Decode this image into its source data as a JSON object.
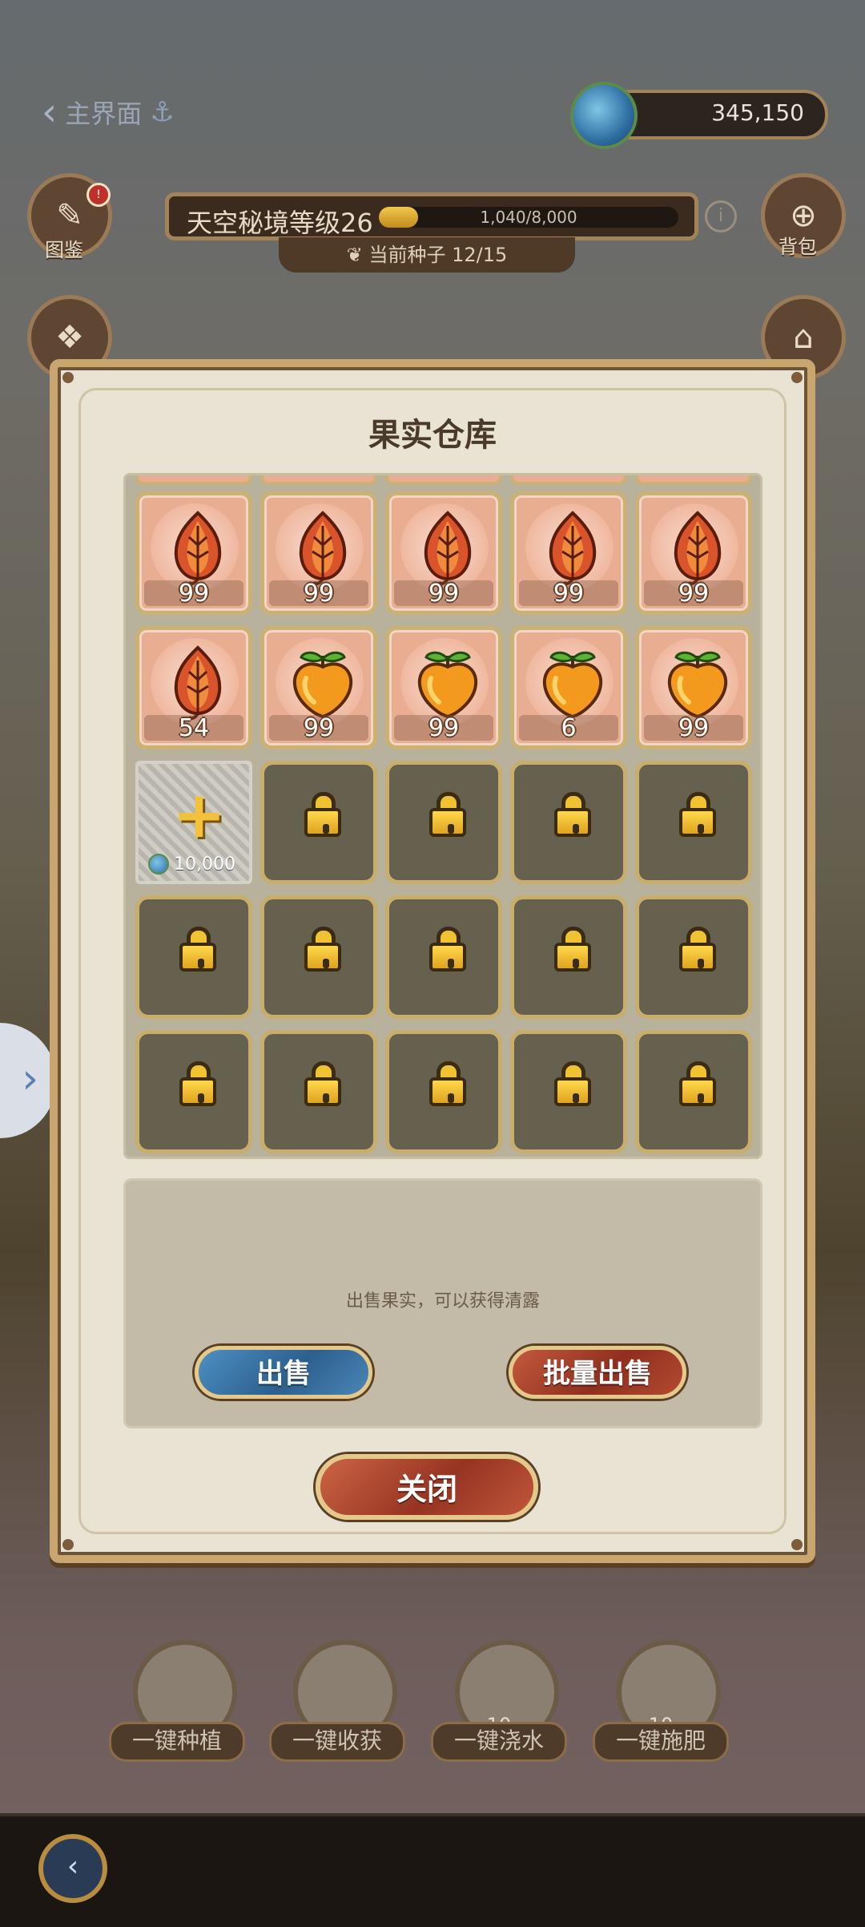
{
  "top": {
    "back_label": "主界面",
    "currency_amount": "345,150",
    "left_buttons": [
      {
        "label": "图鉴",
        "icon": "quill-icon"
      },
      {
        "label": "",
        "icon": "gift-icon"
      }
    ],
    "right_buttons": [
      {
        "label": "背包",
        "icon": "backpack-icon"
      },
      {
        "label": "",
        "icon": "house-icon"
      }
    ],
    "level_title": "天空秘境等级26",
    "xp_text": "1,040/8,000",
    "xp_progress": 0.13,
    "seed_text": "当前种子 12/15"
  },
  "modal": {
    "title": "果实仓库",
    "slots_row1": [
      {
        "kind": "leaf",
        "count": "99"
      },
      {
        "kind": "leaf",
        "count": "99"
      },
      {
        "kind": "leaf",
        "count": "99"
      },
      {
        "kind": "leaf",
        "count": "99"
      },
      {
        "kind": "leaf",
        "count": "99"
      }
    ],
    "slots_row2": [
      {
        "kind": "leaf",
        "count": "54"
      },
      {
        "kind": "peach",
        "count": "99"
      },
      {
        "kind": "peach",
        "count": "99"
      },
      {
        "kind": "peach",
        "count": "6"
      },
      {
        "kind": "peach",
        "count": "99"
      }
    ],
    "unlock_cost": "10,000",
    "sell_hint": "出售果实，可以获得清露",
    "sell_label": "出售",
    "bulk_sell_label": "批量出售",
    "close_label": "关闭"
  },
  "actions": [
    {
      "label": "一键种植",
      "count": ""
    },
    {
      "label": "一键收获",
      "count": ""
    },
    {
      "label": "一键浇水",
      "count": "10"
    },
    {
      "label": "一键施肥",
      "count": "10"
    }
  ],
  "colors": {
    "item_bg": "#e9ad92",
    "locked_bg": "#66604f",
    "gold_border": "#c8ad6b",
    "blue_button": "#2c5f8e",
    "red_button": "#963322"
  }
}
